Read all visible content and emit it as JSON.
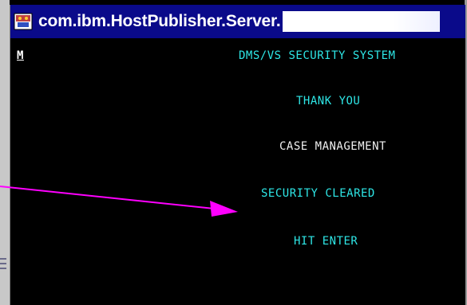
{
  "window": {
    "title": "com.ibm.HostPublisher.Server."
  },
  "screen": {
    "cursor_char": "M",
    "lines": [
      {
        "text": "DMS/VS SECURITY SYSTEM",
        "color": "#2ee6e6"
      },
      {
        "text": "THANK YOU",
        "color": "#2ee6e6"
      },
      {
        "text": "CASE MANAGEMENT",
        "color": "#f0f0f0"
      },
      {
        "text": "SECURITY CLEARED",
        "color": "#2ee6e6"
      },
      {
        "text": "HIT ENTER",
        "color": "#2ee6e6"
      }
    ]
  },
  "annotation": {
    "arrow_color": "#ff00ff"
  },
  "colors": {
    "titlebar": "#0a0a8a",
    "terminal_bg": "#000000"
  },
  "icons": {
    "app_icon": "terminal-app-icon",
    "arrow": "annotation-arrow"
  }
}
